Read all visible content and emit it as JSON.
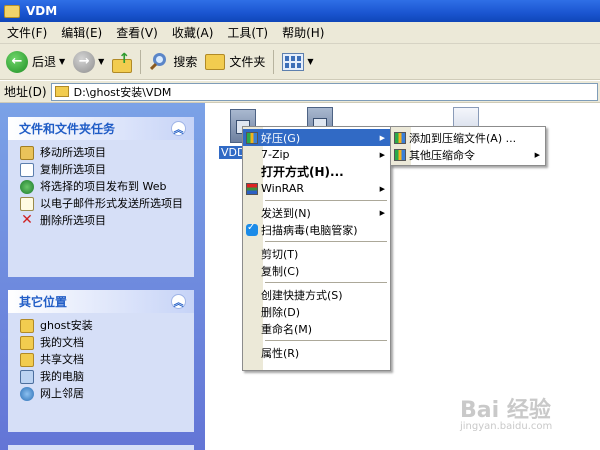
{
  "window": {
    "title": "VDM"
  },
  "menubar": [
    "文件(F)",
    "编辑(E)",
    "查看(V)",
    "收藏(A)",
    "工具(T)",
    "帮助(H)"
  ],
  "toolbar": {
    "back": "后退",
    "search": "搜索",
    "folders": "文件夹"
  },
  "address": {
    "label": "地址(D)",
    "path": "D:\\ghost安装\\VDM"
  },
  "tasks": {
    "title": "文件和文件夹任务",
    "items": [
      "移动所选项目",
      "复制所选项目",
      "将选择的项目发布到 Web",
      "以电子邮件形式发送所选项目",
      "删除所选项目"
    ]
  },
  "places": {
    "title": "其它位置",
    "items": [
      "ghost安装",
      "我的文档",
      "共享文档",
      "我的电脑",
      "网上邻居"
    ]
  },
  "files": {
    "selected_label": "VDD"
  },
  "context_menu": {
    "items": [
      "好压(G)",
      "7-Zip",
      "打开方式(H)...",
      "WinRAR",
      "发送到(N)",
      "扫描病毒(电脑管家)",
      "剪切(T)",
      "复制(C)",
      "创建快捷方式(S)",
      "删除(D)",
      "重命名(M)",
      "属性(R)"
    ]
  },
  "submenu": {
    "items": [
      "添加到压缩文件(A) ...",
      "其他压缩命令"
    ]
  },
  "watermark": {
    "brand": "Bai 经验",
    "url": "jingyan.baidu.com"
  }
}
